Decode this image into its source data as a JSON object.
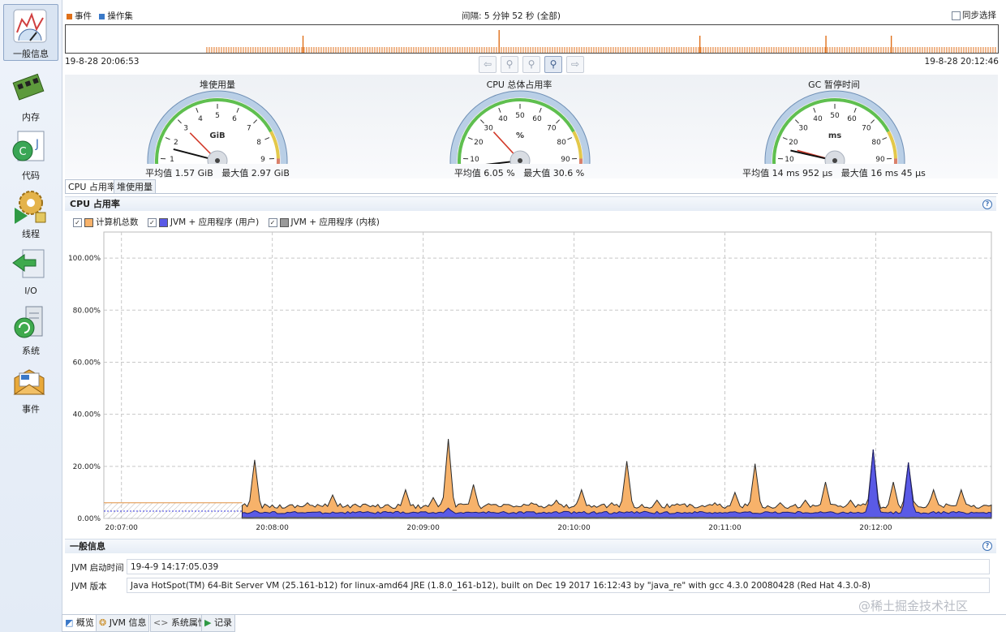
{
  "sidebar": {
    "items": [
      {
        "label": "一般信息",
        "icon": "gauge-icon",
        "active": true
      },
      {
        "label": "内存",
        "icon": "memory-chip-icon",
        "active": false
      },
      {
        "label": "代码",
        "icon": "code-java-icon",
        "active": false
      },
      {
        "label": "线程",
        "icon": "thread-gear-icon",
        "active": false
      },
      {
        "label": "I/O",
        "icon": "io-arrows-icon",
        "active": false
      },
      {
        "label": "系统",
        "icon": "system-server-icon",
        "active": false
      },
      {
        "label": "事件",
        "icon": "event-mail-icon",
        "active": false
      }
    ]
  },
  "timeline": {
    "legend_events": "事件",
    "legend_opsets": "操作集",
    "interval_label": "间隔: 5 分钟 52 秒 (全部)",
    "sync_label": "同步选择",
    "start_time": "19-8-28 20:06:53",
    "end_time": "19-8-28 20:12:46",
    "colors": {
      "events": "#e0701a",
      "opsets": "#3a79c8"
    },
    "spikes": [
      0.255,
      0.465,
      0.68,
      0.815,
      0.885
    ],
    "tick_start": 0.152
  },
  "gauges": [
    {
      "title": "堆使用量",
      "unit": "GiB",
      "ticks": [
        "0",
        "1",
        "2",
        "3",
        "4",
        "5",
        "6",
        "7",
        "8",
        "9",
        "10"
      ],
      "min": 0,
      "max": 10,
      "value": 1.57,
      "max_value": 2.97,
      "stats_avg": "平均值 1.57 GiB",
      "stats_max": "最大值 2.97 GiB"
    },
    {
      "title": "CPU 总体占用率",
      "unit": "%",
      "ticks": [
        "0",
        "10",
        "20",
        "30",
        "40",
        "50",
        "60",
        "70",
        "80",
        "90",
        "100"
      ],
      "min": 0,
      "max": 100,
      "value": 6.05,
      "max_value": 30.6,
      "stats_avg": "平均值 6.05 %",
      "stats_max": "最大值 30.6 %"
    },
    {
      "title": "GC 暂停时间",
      "unit": "ms",
      "ticks": [
        "0",
        "10",
        "20",
        "30",
        "40",
        "50",
        "60",
        "70",
        "80",
        "90",
        "100"
      ],
      "min": 0,
      "max": 100,
      "value": 14.952,
      "max_value": 16.045,
      "stats_avg": "平均值 14 ms 952 μs",
      "stats_max": "最大值 16 ms 45 μs"
    }
  ],
  "tabs": [
    "CPU 占用率",
    "堆使用量"
  ],
  "cpu_panel": {
    "title": "CPU 占用率",
    "help": "?",
    "legend": [
      {
        "label": "计算机总数",
        "color": "#f7b26a",
        "checked": "✓"
      },
      {
        "label": "JVM + 应用程序 (用户)",
        "color": "#5a5ae6",
        "checked": "✓"
      },
      {
        "label": "JVM + 应用程序 (内核)",
        "color": "#9a9a9a",
        "checked": "✓"
      }
    ]
  },
  "chart_data": {
    "type": "area",
    "y_ticks": [
      "0.00%",
      "20.00%",
      "40.00%",
      "60.00%",
      "80.00%",
      "100.00%"
    ],
    "x_ticks": [
      "20:07:00",
      "20:08:00",
      "20:09:00",
      "20:10:00",
      "20:11:00",
      "20:12:00"
    ],
    "ylim": [
      0,
      110
    ],
    "xlim": [
      "20:06:53",
      "20:12:46"
    ],
    "grid": true,
    "no_data_until": "20:07:48",
    "no_data_level": {
      "total": 6.0,
      "jvm": 2.8
    },
    "series": [
      {
        "name": "计算机总数",
        "color": "#f7b26a",
        "peaks": [
          [
            "20:07:53",
            22.5
          ],
          [
            "20:08:14",
            6
          ],
          [
            "20:08:24",
            9
          ],
          [
            "20:08:40",
            5
          ],
          [
            "20:08:53",
            11
          ],
          [
            "20:09:04",
            8
          ],
          [
            "20:09:10",
            30.5
          ],
          [
            "20:09:20",
            13
          ],
          [
            "20:09:33",
            5
          ],
          [
            "20:09:43",
            6
          ],
          [
            "20:09:53",
            7
          ],
          [
            "20:10:03",
            11
          ],
          [
            "20:10:15",
            6
          ],
          [
            "20:10:21",
            22
          ],
          [
            "20:10:33",
            7
          ],
          [
            "20:10:51",
            5
          ],
          [
            "20:10:56",
            6
          ],
          [
            "20:11:04",
            10
          ],
          [
            "20:11:12",
            21
          ],
          [
            "20:11:22",
            6
          ],
          [
            "20:11:32",
            7
          ],
          [
            "20:11:40",
            14
          ],
          [
            "20:11:50",
            7
          ],
          [
            "20:11:59",
            26.5
          ],
          [
            "20:12:07",
            14
          ],
          [
            "20:12:13",
            21.5
          ],
          [
            "20:12:23",
            11
          ],
          [
            "20:12:34",
            11
          ]
        ],
        "baseline": 3.8
      },
      {
        "name": "JVM + 应用程序 (用户)",
        "color": "#5a5ae6",
        "peaks": [
          [
            "20:07:53",
            3
          ],
          [
            "20:09:10",
            4
          ],
          [
            "20:11:59",
            26.5
          ],
          [
            "20:12:13",
            21.5
          ]
        ],
        "baseline": 1.8
      },
      {
        "name": "JVM + 应用程序 (内核)",
        "color": "#9a9a9a",
        "peaks": [],
        "baseline": 0.3
      }
    ]
  },
  "general_panel": {
    "title": "一般信息",
    "help": "?",
    "jvm_start_label": "JVM 启动时间",
    "jvm_start_value": "19-4-9 14:17:05.039",
    "jvm_version_label": "JVM 版本",
    "jvm_version_value": "Java HotSpot(TM) 64-Bit Server VM (25.161-b12) for linux-amd64 JRE (1.8.0_161-b12), built on Dec 19 2017 16:12:43 by \"java_re\" with gcc 4.3.0 20080428 (Red Hat 4.3.0-8)"
  },
  "bottom_tabs": [
    {
      "label": "概览",
      "icon": "overview-icon"
    },
    {
      "label": "JVM 信息",
      "icon": "jvm-info-icon"
    },
    {
      "label": "系统属性",
      "icon": "system-properties-icon"
    },
    {
      "label": "记录",
      "icon": "record-play-icon"
    }
  ],
  "watermark": "@稀土掘金技术社区"
}
